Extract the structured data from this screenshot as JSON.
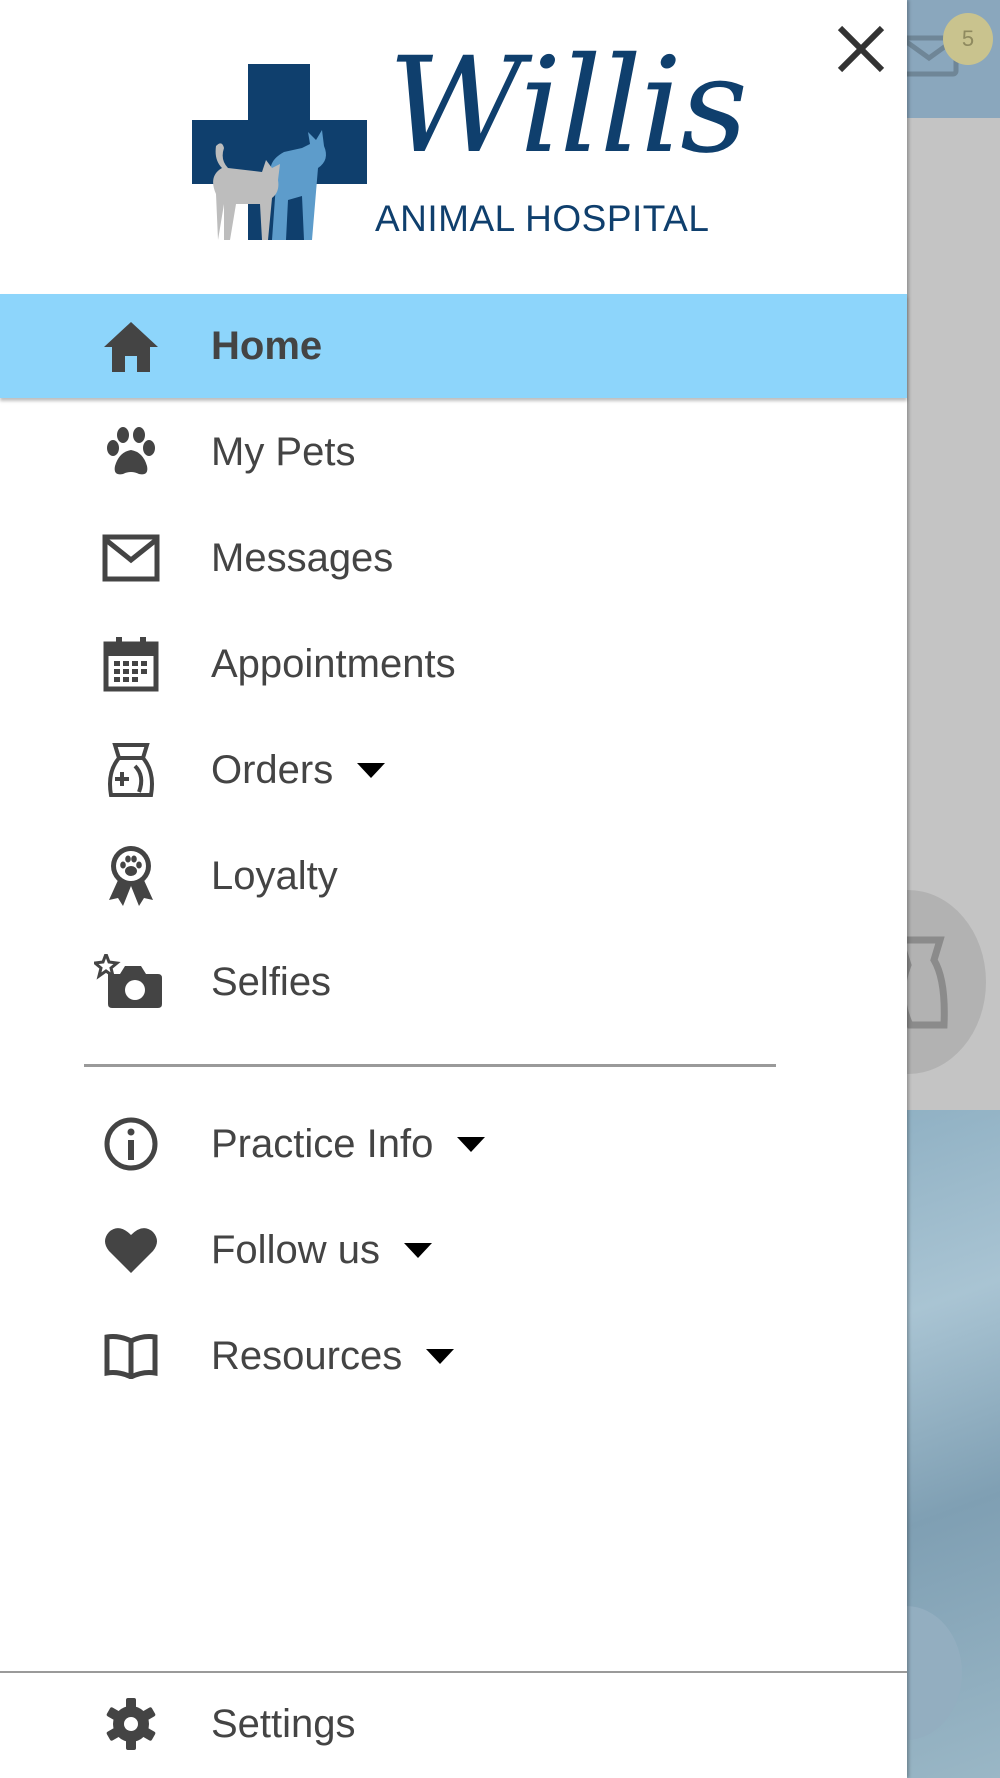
{
  "colors": {
    "active_item_bg": "#8dd5fb",
    "brand_blue": "#0f3f6d",
    "logo_light_blue": "#5d9ccb",
    "icon_gray": "#444444"
  },
  "background": {
    "notification_badge": "5"
  },
  "logo": {
    "name": "Willis",
    "subtitle": "ANIMAL HOSPITAL"
  },
  "menu": {
    "items": [
      {
        "label": "Home",
        "icon": "home-icon",
        "active": true
      },
      {
        "label": "My Pets",
        "icon": "paw-icon"
      },
      {
        "label": "Messages",
        "icon": "envelope-icon"
      },
      {
        "label": "Appointments",
        "icon": "calendar-icon"
      },
      {
        "label": "Orders",
        "icon": "pet-food-bag-icon",
        "has_dropdown": true
      },
      {
        "label": "Loyalty",
        "icon": "award-ribbon-icon"
      },
      {
        "label": "Selfies",
        "icon": "camera-sparkle-icon"
      },
      {
        "label": "Practice Info",
        "icon": "info-icon",
        "has_dropdown": true
      },
      {
        "label": "Follow us",
        "icon": "heart-icon",
        "has_dropdown": true
      },
      {
        "label": "Resources",
        "icon": "book-icon",
        "has_dropdown": true
      }
    ],
    "settings": {
      "label": "Settings",
      "icon": "gear-icon"
    }
  }
}
